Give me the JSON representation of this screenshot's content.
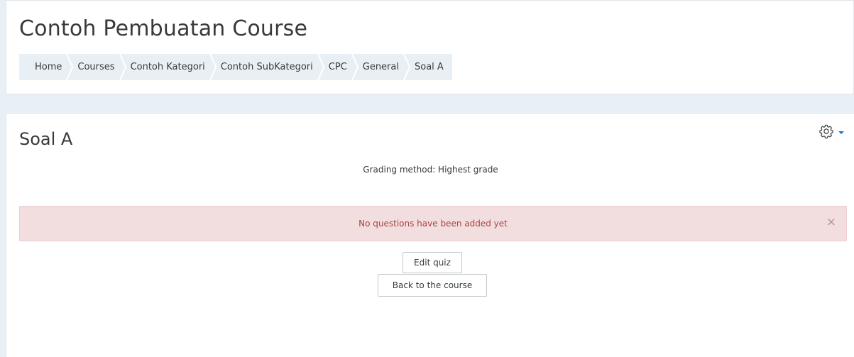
{
  "header": {
    "title": "Contoh Pembuatan Course",
    "breadcrumb": [
      "Home",
      "Courses",
      "Contoh Kategori",
      "Contoh SubKategori",
      "CPC",
      "General",
      "Soal A"
    ]
  },
  "quiz": {
    "title": "Soal A",
    "settings_icon": "gear-icon",
    "grading_method": "Grading method: Highest grade",
    "alert": {
      "message": "No questions have been added yet",
      "close_label": "×"
    },
    "edit_button": "Edit quiz",
    "back_button": "Back to the course"
  },
  "colors": {
    "accent": "#1177d1",
    "alert_bg": "#f2dede",
    "alert_text": "#a94442",
    "page_bg": "#e9f0f5"
  }
}
